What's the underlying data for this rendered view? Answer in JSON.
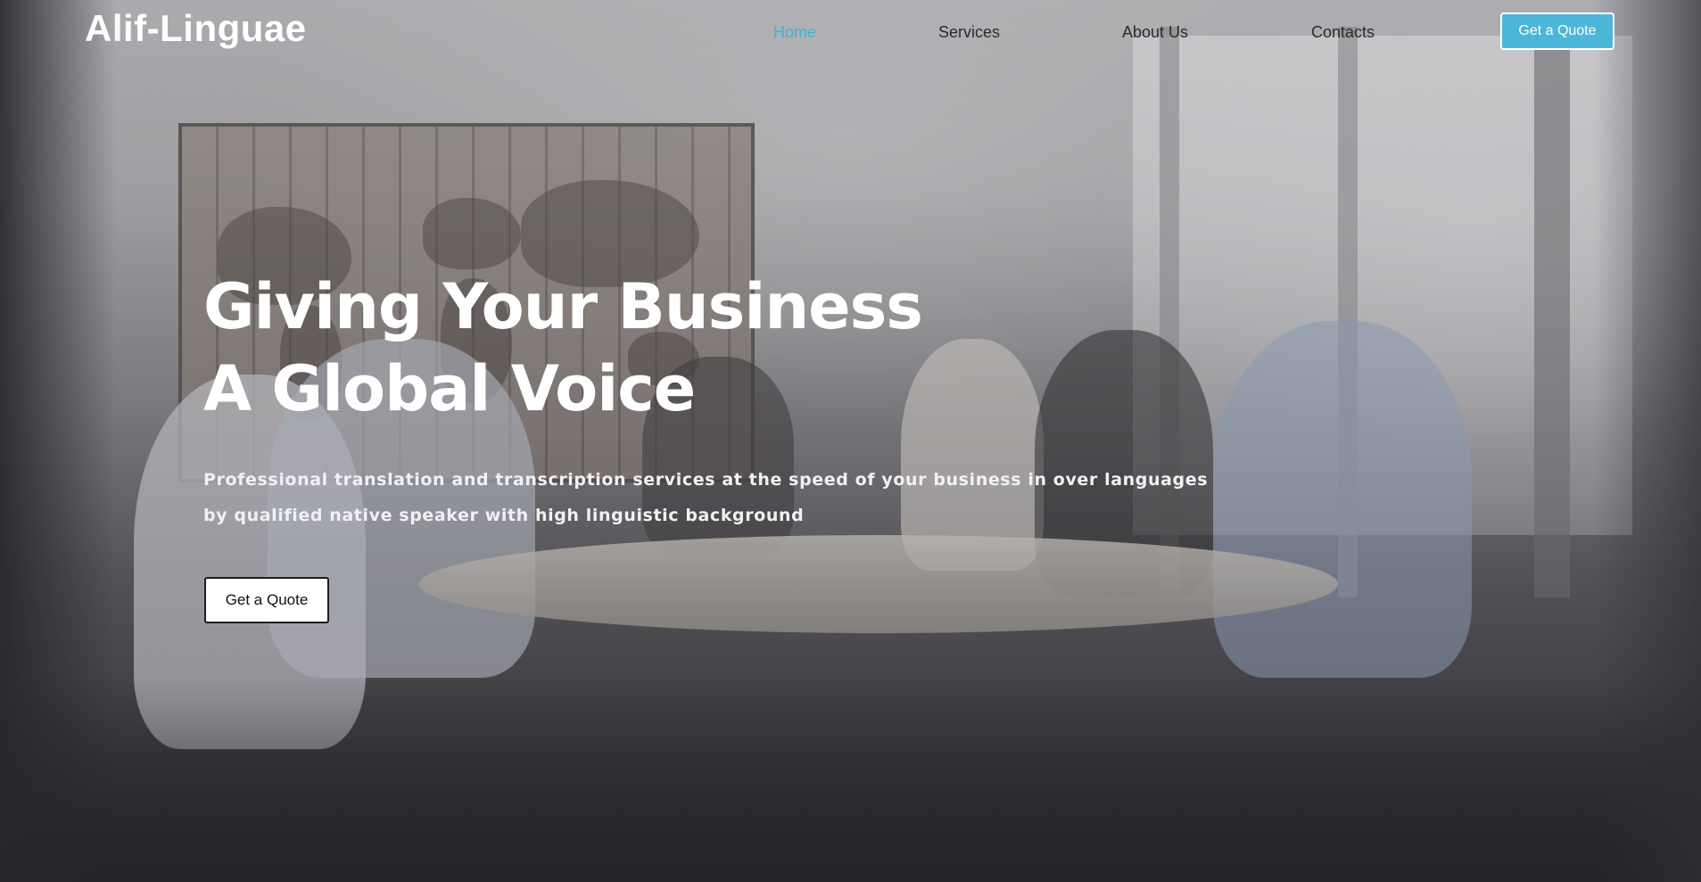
{
  "header": {
    "logo": "Alif-Linguae",
    "nav": [
      {
        "label": "Home",
        "active": true
      },
      {
        "label": "Services",
        "active": false
      },
      {
        "label": "About Us",
        "active": false
      },
      {
        "label": "Contacts",
        "active": false
      }
    ],
    "cta_label": "Get a Quote"
  },
  "hero": {
    "title_line1": "Giving Your Business",
    "title_line2": "A Global Voice",
    "subtitle_line1": "Professional translation and transcription services at the speed of your business in over languages",
    "subtitle_line2": "by qualified native speaker with high linguistic background",
    "cta_label": "Get a Quote"
  },
  "colors": {
    "accent": "#4bb6d8",
    "nav_active": "#3fb3d6",
    "nav_text": "#2b2b2b",
    "hero_text": "#ffffff"
  }
}
